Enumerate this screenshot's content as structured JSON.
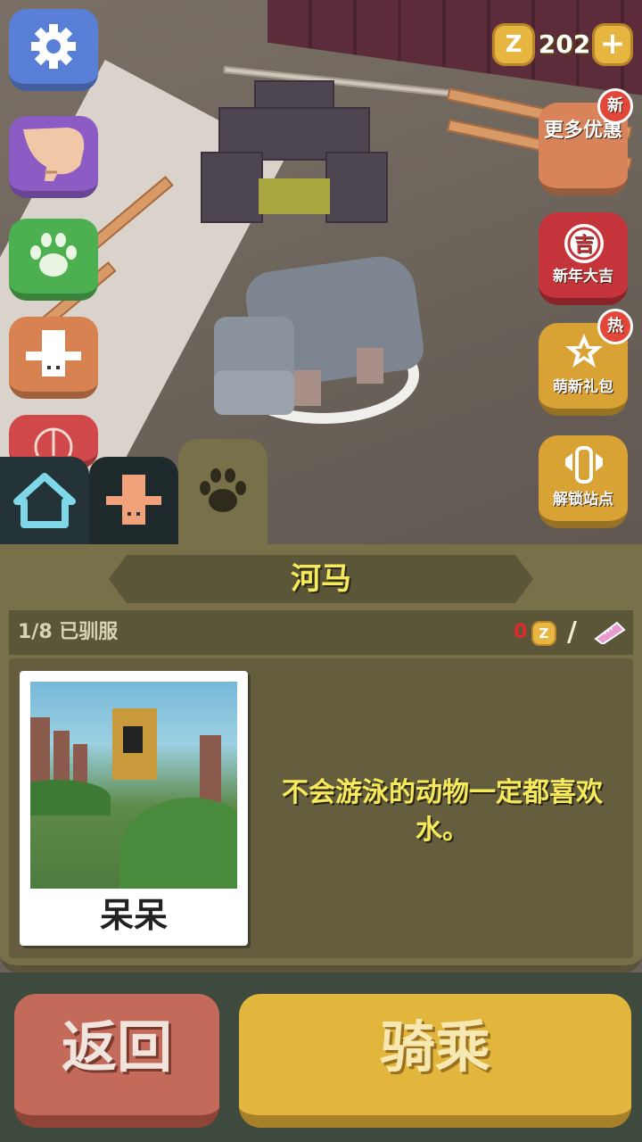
{
  "currency": {
    "icon": "z-coin-icon",
    "amount": "202",
    "add_label": "+"
  },
  "events": [
    {
      "label": "更多优惠",
      "badge": "新",
      "icon": "promo-icon"
    },
    {
      "label": "新年大吉",
      "badge": "",
      "icon": "ji-icon",
      "glyph": "吉"
    },
    {
      "label": "萌新礼包",
      "badge": "热",
      "icon": "stars-gift-icon"
    },
    {
      "label": "解锁站点",
      "badge": "",
      "icon": "unlock-station-icon"
    }
  ],
  "side_buttons": [
    "gear-icon",
    "hand-icon",
    "paw-icon",
    "cowboy-hat-icon",
    "lantern-icon"
  ],
  "tabs": [
    "home-icon",
    "cowboy-hat-icon",
    "paw-icon"
  ],
  "panel": {
    "animal_name": "河马",
    "tamed_text": "1/8 已驯服",
    "coin_count": "0",
    "coin_glyph": "Z",
    "separator": "/",
    "photo_name": "呆呆",
    "description": "不会游泳的动物一定都喜欢水。"
  },
  "buttons": {
    "back": "返回",
    "ride": "骑乘"
  },
  "colors": {
    "accent_yellow": "#f6ea5b",
    "panel": "#787048",
    "ride": "#e2b63c",
    "back": "#c46a5a"
  }
}
